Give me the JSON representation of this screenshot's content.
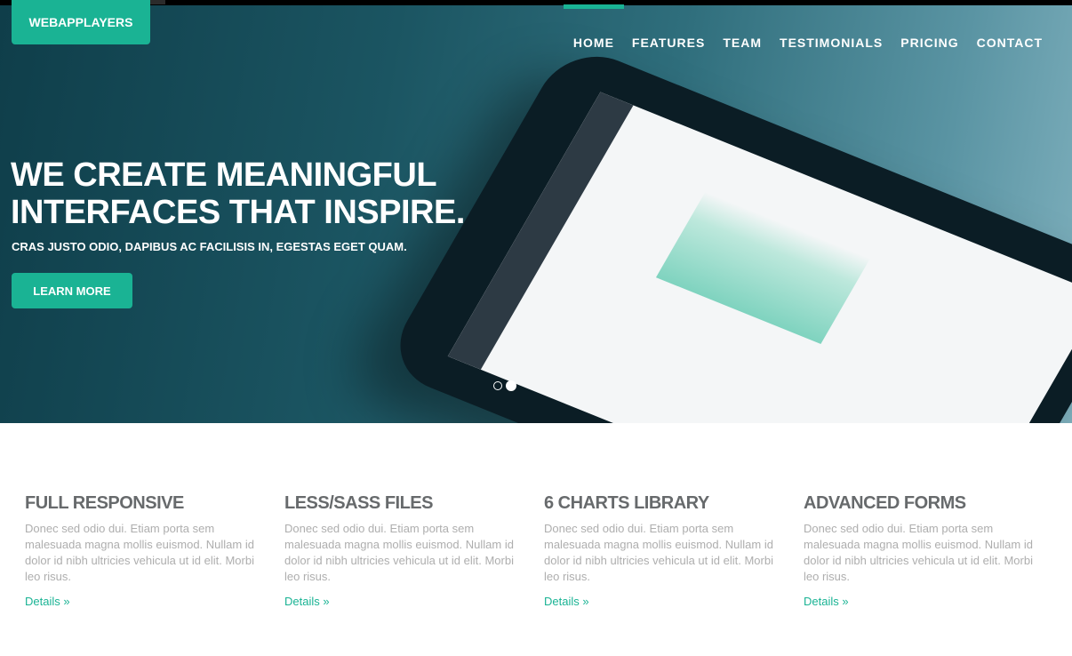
{
  "brand": "WEBAPPLAYERS",
  "nav": [
    "HOME",
    "FEATURES",
    "TEAM",
    "TESTIMONIALS",
    "PRICING",
    "CONTACT"
  ],
  "nav_active": "HOME",
  "hero": {
    "title_line1": "WE CREATE MEANINGFUL",
    "title_line2": "INTERFACES THAT INSPIRE.",
    "subtitle": "CRAS JUSTO ODIO, DAPIBUS AC FACILISIS IN, EGESTAS EGET QUAM.",
    "button": "LEARN MORE",
    "slides": 2,
    "active_slide": 2
  },
  "accent": "#1ab394",
  "features": [
    {
      "title": "FULL RESPONSIVE",
      "text": "Donec sed odio dui. Etiam porta sem malesuada magna mollis euismod. Nullam id dolor id nibh ultricies vehicula ut id elit. Morbi leo risus.",
      "link": "Details »"
    },
    {
      "title": "LESS/SASS FILES",
      "text": "Donec sed odio dui. Etiam porta sem malesuada magna mollis euismod. Nullam id dolor id nibh ultricies vehicula ut id elit. Morbi leo risus.",
      "link": "Details »"
    },
    {
      "title": "6 CHARTS LIBRARY",
      "text": "Donec sed odio dui. Etiam porta sem malesuada magna mollis euismod. Nullam id dolor id nibh ultricies vehicula ut id elit. Morbi leo risus.",
      "link": "Details »"
    },
    {
      "title": "ADVANCED FORMS",
      "text": "Donec sed odio dui. Etiam porta sem malesuada magna mollis euismod. Nullam id dolor id nibh ultricies vehicula ut id elit. Morbi leo risus.",
      "link": "Details »"
    }
  ]
}
